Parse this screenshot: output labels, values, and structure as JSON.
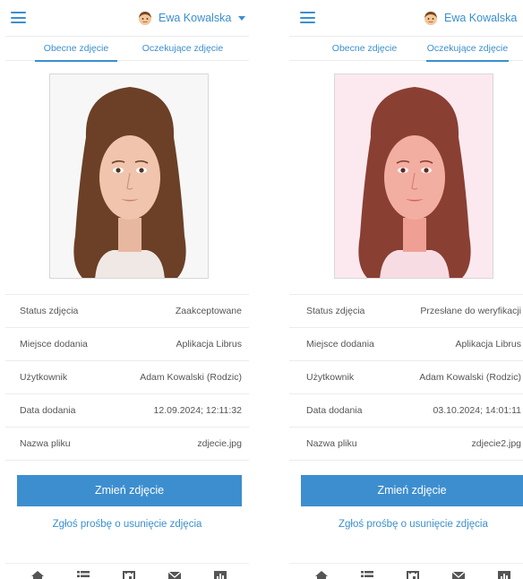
{
  "screens": [
    {
      "user_name": "Ewa Kowalska",
      "tabs": [
        {
          "label": "Obecne zdjęcie",
          "active": true
        },
        {
          "label": "Oczekujące zdjęcie",
          "active": false
        }
      ],
      "photo_tint": "none",
      "info_rows": [
        {
          "label": "Status zdjęcia",
          "value": "Zaakceptowane"
        },
        {
          "label": "Miejsce dodania",
          "value": "Aplikacja Librus"
        },
        {
          "label": "Użytkownik",
          "value": "Adam Kowalski (Rodzic)"
        },
        {
          "label": "Data dodania",
          "value": "12.09.2024; 12:11:32"
        },
        {
          "label": "Nazwa pliku",
          "value": "zdjecie.jpg"
        }
      ],
      "primary_button": "Zmień zdjęcie",
      "secondary_link": "Zgłoś prośbę o usunięcie zdjęcia"
    },
    {
      "user_name": "Ewa Kowalska",
      "tabs": [
        {
          "label": "Obecne zdjęcie",
          "active": false
        },
        {
          "label": "Oczekujące zdjęcie",
          "active": true
        }
      ],
      "photo_tint": "pink",
      "info_rows": [
        {
          "label": "Status zdjęcia",
          "value": "Przesłane do weryfikacji"
        },
        {
          "label": "Miejsce dodania",
          "value": "Aplikacja Librus"
        },
        {
          "label": "Użytkownik",
          "value": "Adam Kowalski (Rodzic)"
        },
        {
          "label": "Data dodania",
          "value": "03.10.2024; 14:01:11"
        },
        {
          "label": "Nazwa pliku",
          "value": "zdjecie2.jpg"
        }
      ],
      "primary_button": "Zmień zdjęcie",
      "secondary_link": "Zgłoś prośbę o usunięcie zdjęcia"
    }
  ],
  "bottom_nav": [
    {
      "icon": "home-icon"
    },
    {
      "icon": "list-icon"
    },
    {
      "icon": "calendar-icon"
    },
    {
      "icon": "mail-icon"
    },
    {
      "icon": "chart-icon"
    }
  ],
  "colors": {
    "accent": "#3a8fd0",
    "button": "#3d8ecf",
    "divider": "#ececec",
    "nav_icon": "#555555"
  }
}
